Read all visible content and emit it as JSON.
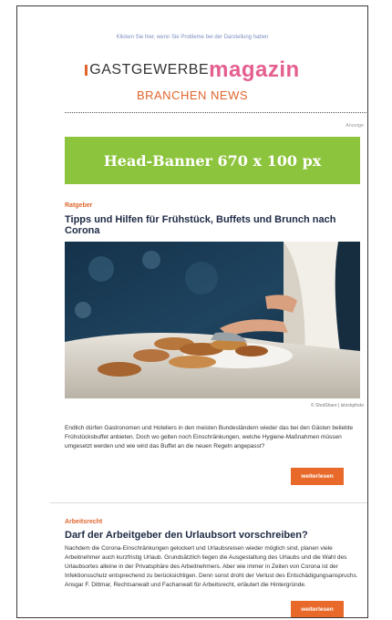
{
  "header": {
    "top_link": "Klicken Sie hier, wenn Sie Probleme bei der Darstellung haben",
    "logo_part1": "GASTGEWERBE",
    "logo_part2": "magazin",
    "subtitle": "BRANCHEN NEWS"
  },
  "ad": {
    "label": "Anzeige",
    "banner_text": "Head-Banner 670 x 100 px",
    "banner_color": "#8dc43e"
  },
  "articles": [
    {
      "category": "Ratgeber",
      "title": "Tipps und Hilfen für Frühstück, Buffets und Brunch nach Corona",
      "image_credit": "© ShotShare | istockphoto",
      "text": "Endlich dürfen Gastronomen und Hoteliers in den meisten Bundesländern wieder das bei den Gästen beliebte Frühstücksbuffet anbieten. Doch wo gelten noch Einschränkungen, welche Hygiene-Maßnahmen müssen umgesetzt werden und wie wird das Buffet an die neuen Regeln angepasst?",
      "button": "weiterlesen"
    },
    {
      "category": "Arbeitsrecht",
      "title": "Darf der Arbeitgeber den Urlaubsort vorschreiben?",
      "text": "Nachdem die Corona-Einschränkungen gelockert und Urlaubsreisen wieder möglich sind, planen viele Arbeitnehmer auch kurzfristig Urlaub. Grundsätzlich liegen die Ausgestaltung des Urlaubs und die Wahl des Urlaubsortes alleine in der Privatsphäre des Arbeitnehmers. Aber wie immer in Zeiten von Corona ist der Infektionsschutz entsprechend zu berücksichtigen. Denn sonst droht der Verlust des Entschädigungsanspruchs. Ansgar F. Dittmar, Rechtsanwalt und Fachanwalt für Arbeitsrecht, erläutert die Hintergründe.",
      "button": "weiterlesen"
    }
  ],
  "colors": {
    "accent": "#e0662e",
    "button": "#e8692a",
    "logo_pink": "#e45f8f",
    "title": "#1e2a45"
  }
}
